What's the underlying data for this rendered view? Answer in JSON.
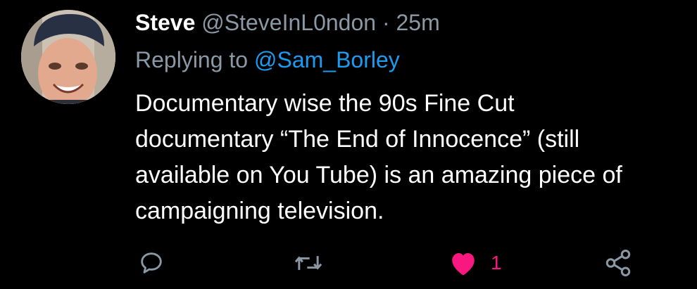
{
  "tweet": {
    "author_name": "Steve",
    "handle": "@SteveInL0ndon",
    "separator": "·",
    "time": "25m",
    "reply_prefix": "Replying to",
    "reply_mention": "@Sam_Borley",
    "text": "Documentary wise the 90s Fine Cut\ndocumentary “The End of Innocence” (still\navailable on You Tube) is an amazing piece of\ncampaigning television."
  },
  "actions": {
    "reply_icon": "speech-bubble-icon",
    "retweet_icon": "retweet-arrows-icon",
    "like_icon": "heart-icon",
    "like_count": "1",
    "share_icon": "share-nodes-icon"
  },
  "colors": {
    "background": "#000000",
    "secondary_text": "#8b98a5",
    "mention": "#1d9bf0",
    "like": "#f91880"
  }
}
